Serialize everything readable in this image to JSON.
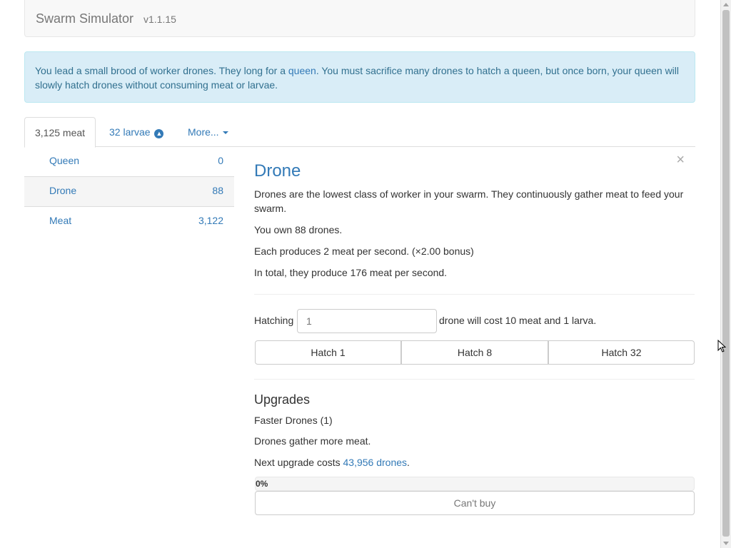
{
  "navbar": {
    "brand": "Swarm Simulator",
    "version": "v1.1.15"
  },
  "alert": {
    "text_before": "You lead a small brood of worker drones. They long for a ",
    "link": "queen",
    "text_after": ". You must sacrifice many drones to hatch a queen, but once born, your queen will slowly hatch drones without consuming meat or larvae."
  },
  "tabs": {
    "meat": "3,125 meat",
    "larvae": "32 larvae",
    "more": "More...",
    "larvae_icon": "arrow-circle-up-icon",
    "more_icon": "caret-down-icon"
  },
  "units": [
    {
      "name": "Queen",
      "count": "0"
    },
    {
      "name": "Drone",
      "count": "88"
    },
    {
      "name": "Meat",
      "count": "3,122"
    }
  ],
  "detail": {
    "title": "Drone",
    "description": "Drones are the lowest class of worker in your swarm. They continuously gather meat to feed your swarm.",
    "own": "You own 88 drones.",
    "produces": "Each produces 2 meat per second. (×2.00 bonus)",
    "total": "In total, they produce 176 meat per second.",
    "hatching_label": "Hatching",
    "hatch_placeholder": "1",
    "hatch_cost": "drone will cost 10 meat and 1 larva.",
    "buttons": [
      "Hatch 1",
      "Hatch 8",
      "Hatch 32"
    ],
    "close": "×"
  },
  "upgrades": {
    "title": "Upgrades",
    "name": "Faster Drones (1)",
    "description": "Drones gather more meat.",
    "cost_prefix": "Next upgrade costs ",
    "cost_link": "43,956 drones",
    "cost_suffix": ".",
    "progress_label": "0%",
    "progress": 0,
    "cant_buy": "Can't buy"
  },
  "colors": {
    "accent": "#337ab7",
    "alert_bg": "#d9edf7",
    "alert_text": "#31708f"
  }
}
